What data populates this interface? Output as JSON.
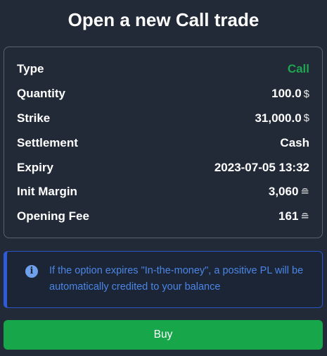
{
  "title": "Open a new Call trade",
  "details": [
    {
      "label": "Type",
      "value": "Call",
      "unit": ""
    },
    {
      "label": "Quantity",
      "value": "100.0",
      "unit": "$"
    },
    {
      "label": "Strike",
      "value": "31,000.0",
      "unit": "$"
    },
    {
      "label": "Settlement",
      "value": "Cash",
      "unit": ""
    },
    {
      "label": "Expiry",
      "value": "2023-07-05 13:32",
      "unit": ""
    },
    {
      "label": "Init Margin",
      "value": "3,060",
      "unit": "≘"
    },
    {
      "label": "Opening Fee",
      "value": "161",
      "unit": "≘"
    }
  ],
  "info": {
    "icon": "info-icon",
    "text": "If the option expires \"In-the-money\", a positive PL will be automatically credited to your balance"
  },
  "buy_label": "Buy",
  "colors": {
    "background": "#222a38",
    "call": "#1fa54f",
    "info_text": "#4b86e6",
    "info_border": "#2f5bd8",
    "buy_button": "#17a64a"
  }
}
